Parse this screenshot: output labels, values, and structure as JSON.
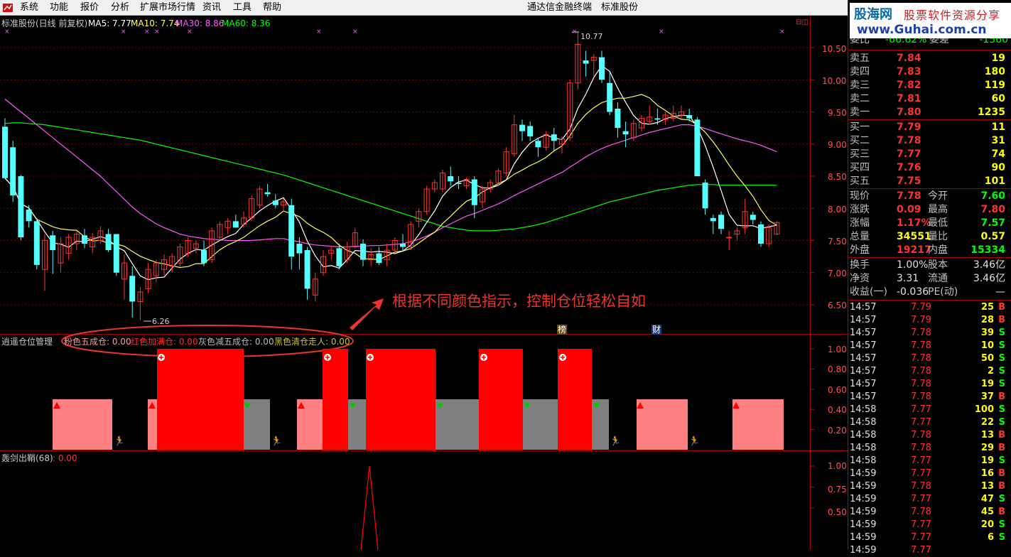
{
  "menubar": {
    "logo_icon": "app-logo-icon",
    "items": [
      "系统",
      "功能",
      "报价",
      "分析",
      "扩展市场行情",
      "资讯",
      "工具",
      "帮助"
    ],
    "window_title": "通达信金融终端　标准股份"
  },
  "main_chart": {
    "title": "标准股份(日线 前复权)",
    "ma5_label": "MA5: 7.77",
    "ma10_label": "MA10: 7.74",
    "ma30_label": "MA30: 8.86",
    "ma60_label": "MA60: 8.36",
    "ma_colors": {
      "ma5": "#ffffff",
      "ma10": "#ffff55",
      "ma30": "#ff55ff",
      "ma60": "#00ff00"
    },
    "up_color": "#ff3232",
    "down_color": "#54ffff",
    "price_axis": [
      "10.50",
      "10.00",
      "9.50",
      "9.00",
      "8.50",
      "8.00",
      "7.50",
      "7.00",
      "6.50"
    ],
    "high_marker": "10.77",
    "low_marker": "6.26",
    "event_tags": [
      "榜",
      "财"
    ]
  },
  "annotation": "根据不同颜色指示，控制仓位轻松自如",
  "indicator1": {
    "name": "逍遥仓位管理",
    "items": [
      {
        "label": "粉色五成仓: 0.00",
        "color": "#ff9999"
      },
      {
        "label": "红色加满仓: 0.00",
        "color": "#ff2a2a"
      },
      {
        "label": "灰色减五成仓: 0.00",
        "color": "#bbbbbb"
      },
      {
        "label": "黑色清仓走人: 0.00",
        "color": "#c6c626"
      }
    ],
    "axis": [
      "1.00",
      "0.80",
      "0.60",
      "0.40",
      "0.20"
    ]
  },
  "indicator2": {
    "name": "轰剑出鞘(68)",
    "value": ": 0.00",
    "axis": [
      "1.00",
      "0.75",
      "0.50"
    ]
  },
  "banner": {
    "line1": "股海网",
    "line2": "股票软件资源分享",
    "line3": "www.Guhai.com.cn"
  },
  "quote": {
    "top_partial": {
      "l1": "委比",
      "v1": "-66.62%",
      "l2": "委差",
      "v2": "-1560"
    },
    "sells": [
      {
        "label": "卖五",
        "price": "7.84",
        "vol": "19"
      },
      {
        "label": "卖四",
        "price": "7.83",
        "vol": "180"
      },
      {
        "label": "卖三",
        "price": "7.82",
        "vol": "119"
      },
      {
        "label": "卖二",
        "price": "7.81",
        "vol": "60"
      },
      {
        "label": "卖一",
        "price": "7.80",
        "vol": "1235"
      }
    ],
    "buys": [
      {
        "label": "买一",
        "price": "7.79",
        "vol": "11"
      },
      {
        "label": "买二",
        "price": "7.78",
        "vol": "31"
      },
      {
        "label": "买三",
        "price": "7.77",
        "vol": "74"
      },
      {
        "label": "买四",
        "price": "7.76",
        "vol": "90"
      },
      {
        "label": "买五",
        "price": "7.75",
        "vol": "101"
      }
    ],
    "stats": [
      {
        "l1": "现价",
        "v1": "7.78",
        "c1": "#ff3232",
        "l2": "今开",
        "v2": "7.60",
        "c2": "#00ff00"
      },
      {
        "l1": "涨跌",
        "v1": "0.09",
        "c1": "#ff3232",
        "l2": "最高",
        "v2": "7.80",
        "c2": "#ff3232"
      },
      {
        "l1": "涨幅",
        "v1": "1.17%",
        "c1": "#ff3232",
        "l2": "最低",
        "v2": "7.57",
        "c2": "#00ff00"
      },
      {
        "l1": "总量",
        "v1": "34551",
        "c1": "#ffff00",
        "l2": "量比",
        "v2": "0.57",
        "c2": "#ffff00"
      },
      {
        "l1": "外盘",
        "v1": "19217",
        "c1": "#ff3232",
        "l2": "内盘",
        "v2": "15334",
        "c2": "#00ff00"
      }
    ],
    "stats2": [
      {
        "l1": "换手",
        "v1": "1.00%",
        "l2": "股本",
        "v2": "3.46亿"
      },
      {
        "l1": "净资",
        "v1": "3.31",
        "l2": "流通",
        "v2": "3.46亿"
      },
      {
        "l1": "收益(一)",
        "v1": "-0.036",
        "l2": "PE(动)",
        "v2": "—"
      }
    ]
  },
  "ticks": [
    {
      "time": "14:57",
      "price": "7.79",
      "vol": "25",
      "bs": "B"
    },
    {
      "time": "14:57",
      "price": "7.79",
      "vol": "28",
      "bs": "B"
    },
    {
      "time": "14:57",
      "price": "7.78",
      "vol": "39",
      "bs": "S"
    },
    {
      "time": "14:57",
      "price": "7.78",
      "vol": "10",
      "bs": "S"
    },
    {
      "time": "14:57",
      "price": "7.78",
      "vol": "50",
      "bs": "S"
    },
    {
      "time": "14:57",
      "price": "7.78",
      "vol": "2",
      "bs": "S"
    },
    {
      "time": "14:57",
      "price": "7.78",
      "vol": "19",
      "bs": "S"
    },
    {
      "time": "14:57",
      "price": "7.78",
      "vol": "37",
      "bs": "B"
    },
    {
      "time": "14:58",
      "price": "7.77",
      "vol": "100",
      "bs": "S"
    },
    {
      "time": "14:58",
      "price": "7.77",
      "vol": "22",
      "bs": "S"
    },
    {
      "time": "14:58",
      "price": "7.78",
      "vol": "13",
      "bs": "B"
    },
    {
      "time": "14:58",
      "price": "7.78",
      "vol": "29",
      "bs": "B"
    },
    {
      "time": "14:58",
      "price": "7.77",
      "vol": "19",
      "bs": "S"
    },
    {
      "time": "14:59",
      "price": "7.77",
      "vol": "16",
      "bs": "B"
    },
    {
      "time": "14:59",
      "price": "7.78",
      "vol": "13",
      "bs": "B"
    },
    {
      "time": "14:59",
      "price": "7.77",
      "vol": "47",
      "bs": "S"
    },
    {
      "time": "14:59",
      "price": "7.78",
      "vol": "45",
      "bs": "B"
    },
    {
      "time": "14:59",
      "price": "7.77",
      "vol": "20",
      "bs": "S"
    },
    {
      "time": "14:59",
      "price": "7.77",
      "vol": "6",
      "bs": "S"
    },
    {
      "time": "14:59",
      "price": "7.77",
      "vol": "",
      "bs": ""
    }
  ],
  "candles": [
    [
      9.27,
      9.4,
      8.47,
      8.47
    ],
    [
      8.95,
      9.05,
      8.1,
      8.2
    ],
    [
      8.5,
      8.52,
      7.5,
      7.55
    ],
    [
      7.98,
      8.05,
      7.7,
      7.8
    ],
    [
      7.8,
      7.85,
      7.05,
      7.12
    ],
    [
      7.05,
      7.6,
      6.72,
      7.5
    ],
    [
      7.58,
      7.65,
      6.98,
      7.35
    ],
    [
      7.15,
      7.55,
      7.0,
      7.45
    ],
    [
      7.3,
      7.6,
      7.2,
      7.55
    ],
    [
      7.45,
      7.65,
      7.35,
      7.6
    ],
    [
      7.58,
      7.68,
      7.38,
      7.45
    ],
    [
      7.4,
      7.62,
      7.3,
      7.55
    ],
    [
      7.5,
      7.72,
      7.45,
      7.65
    ],
    [
      7.6,
      7.68,
      7.32,
      7.35
    ],
    [
      7.6,
      7.6,
      6.95,
      7.0
    ],
    [
      6.9,
      7.28,
      6.58,
      7.15
    ],
    [
      6.95,
      7.1,
      6.3,
      6.55
    ],
    [
      6.55,
      6.78,
      6.26,
      6.7
    ],
    [
      6.75,
      7.15,
      6.68,
      7.05
    ],
    [
      6.95,
      7.2,
      6.85,
      7.15
    ],
    [
      7.05,
      7.28,
      6.95,
      7.2
    ],
    [
      7.1,
      7.3,
      7.0,
      7.25
    ],
    [
      7.15,
      7.45,
      7.1,
      7.4
    ],
    [
      7.3,
      7.55,
      7.25,
      7.5
    ],
    [
      7.38,
      7.5,
      7.3,
      7.45
    ],
    [
      7.35,
      7.5,
      7.1,
      7.15
    ],
    [
      7.2,
      7.7,
      7.15,
      7.65
    ],
    [
      7.55,
      7.8,
      7.5,
      7.75
    ],
    [
      7.7,
      7.85,
      7.6,
      7.8
    ],
    [
      7.8,
      7.9,
      7.7,
      7.7
    ],
    [
      7.75,
      7.95,
      7.7,
      7.85
    ],
    [
      7.85,
      8.2,
      7.8,
      8.15
    ],
    [
      8.05,
      8.35,
      8.0,
      8.3
    ],
    [
      8.25,
      8.38,
      8.18,
      8.22
    ],
    [
      8.12,
      8.22,
      8.0,
      8.05
    ],
    [
      8.05,
      8.15,
      7.95,
      8.1
    ],
    [
      8.05,
      8.15,
      7.05,
      7.25
    ],
    [
      7.45,
      7.55,
      7.05,
      7.3
    ],
    [
      7.35,
      7.4,
      6.58,
      6.75
    ],
    [
      6.65,
      7.0,
      6.55,
      6.9
    ],
    [
      7.0,
      7.35,
      6.95,
      7.25
    ],
    [
      7.3,
      7.42,
      7.2,
      7.35
    ],
    [
      7.38,
      7.45,
      7.05,
      7.1
    ],
    [
      7.2,
      7.48,
      7.15,
      7.4
    ],
    [
      7.4,
      7.7,
      7.38,
      7.62
    ],
    [
      7.45,
      7.52,
      7.1,
      7.2
    ],
    [
      7.2,
      7.38,
      7.1,
      7.28
    ],
    [
      7.3,
      7.4,
      7.12,
      7.15
    ],
    [
      7.2,
      7.45,
      7.1,
      7.35
    ],
    [
      7.35,
      7.55,
      7.3,
      7.5
    ],
    [
      7.45,
      7.6,
      7.35,
      7.4
    ],
    [
      7.4,
      7.8,
      7.35,
      7.75
    ],
    [
      7.8,
      8.0,
      7.7,
      7.95
    ],
    [
      7.95,
      8.35,
      7.9,
      8.3
    ],
    [
      8.3,
      8.45,
      8.25,
      8.4
    ],
    [
      8.3,
      8.6,
      8.25,
      8.55
    ],
    [
      8.5,
      8.65,
      8.35,
      8.42
    ],
    [
      8.4,
      8.5,
      8.3,
      8.38
    ],
    [
      8.35,
      8.48,
      8.3,
      8.45
    ],
    [
      8.45,
      8.5,
      7.85,
      8.05
    ],
    [
      8.1,
      8.35,
      8.0,
      8.3
    ],
    [
      8.3,
      8.45,
      8.25,
      8.4
    ],
    [
      8.4,
      8.62,
      8.35,
      8.58
    ],
    [
      8.55,
      8.95,
      8.5,
      8.88
    ],
    [
      8.85,
      9.45,
      8.8,
      9.3
    ],
    [
      9.3,
      9.38,
      9.05,
      9.2
    ],
    [
      9.28,
      9.35,
      9.05,
      9.12
    ],
    [
      9.05,
      9.1,
      8.8,
      8.95
    ],
    [
      8.95,
      9.2,
      8.9,
      9.15
    ],
    [
      9.15,
      9.25,
      8.9,
      9.05
    ],
    [
      9.0,
      9.12,
      8.85,
      9.08
    ],
    [
      9.1,
      10.0,
      9.05,
      9.95
    ],
    [
      9.95,
      10.75,
      9.85,
      10.55
    ],
    [
      10.3,
      10.45,
      10.05,
      10.25
    ],
    [
      10.3,
      10.4,
      10.05,
      10.35
    ],
    [
      10.35,
      10.45,
      9.95,
      10.0
    ],
    [
      9.95,
      10.12,
      9.45,
      9.5
    ],
    [
      9.55,
      9.65,
      9.1,
      9.25
    ],
    [
      9.2,
      9.35,
      8.95,
      9.15
    ],
    [
      9.1,
      9.38,
      9.05,
      9.32
    ],
    [
      9.25,
      9.45,
      9.2,
      9.4
    ],
    [
      9.35,
      9.6,
      9.3,
      9.42
    ],
    [
      9.4,
      9.55,
      9.3,
      9.38
    ],
    [
      9.38,
      9.5,
      9.3,
      9.45
    ],
    [
      9.4,
      9.6,
      9.35,
      9.48
    ],
    [
      9.45,
      9.6,
      9.4,
      9.5
    ],
    [
      9.45,
      9.55,
      9.35,
      9.4
    ],
    [
      9.38,
      9.42,
      8.5,
      8.5
    ],
    [
      8.4,
      8.45,
      7.9,
      8.0
    ],
    [
      7.85,
      7.9,
      7.6,
      7.8
    ],
    [
      7.9,
      7.95,
      7.6,
      7.68
    ],
    [
      7.55,
      7.65,
      7.35,
      7.55
    ],
    [
      7.6,
      7.7,
      7.5,
      7.65
    ],
    [
      7.7,
      8.15,
      7.6,
      7.95
    ],
    [
      7.9,
      7.95,
      7.75,
      7.82
    ],
    [
      7.75,
      7.8,
      7.4,
      7.45
    ],
    [
      7.45,
      7.75,
      7.4,
      7.7
    ],
    [
      7.6,
      7.8,
      7.58,
      7.78
    ]
  ]
}
